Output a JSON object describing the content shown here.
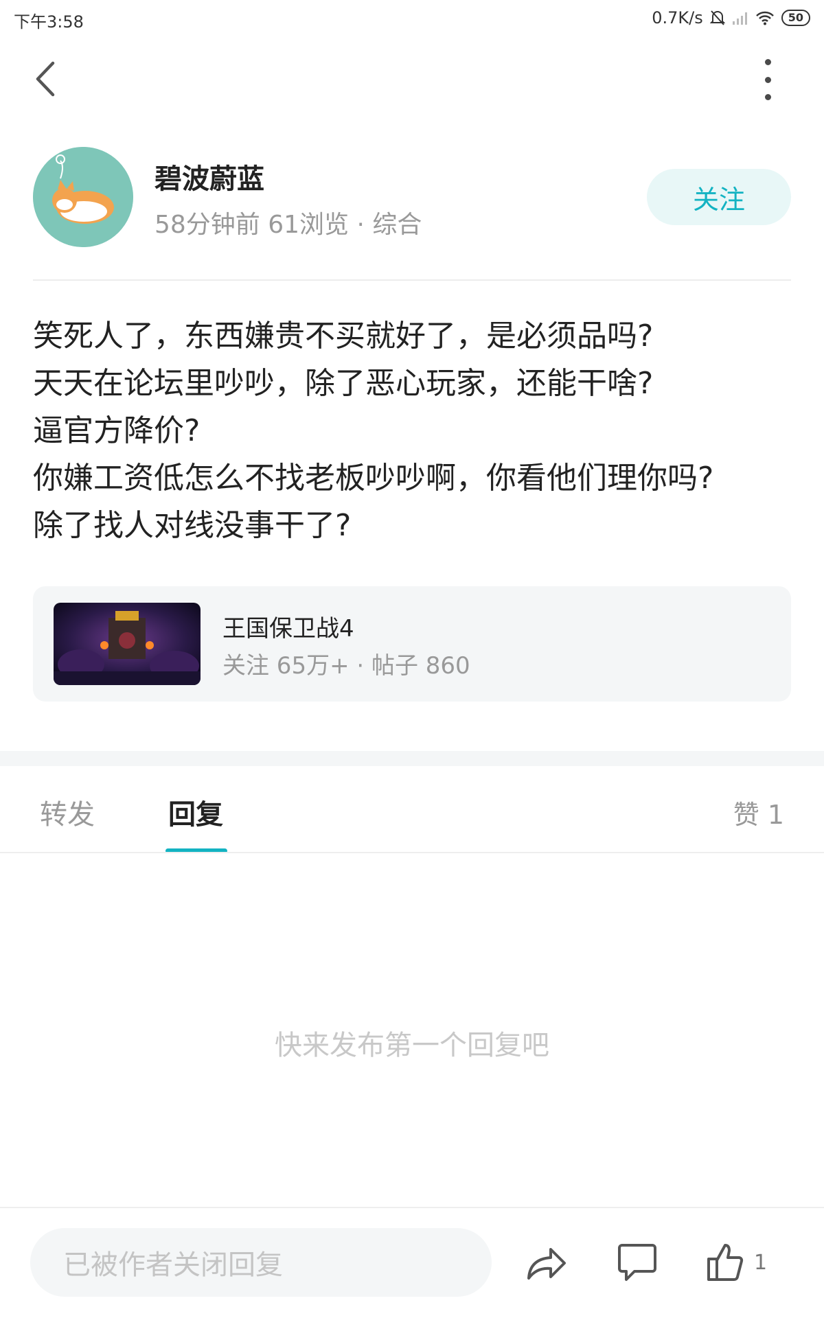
{
  "status_bar": {
    "time": "下午3:58",
    "network_speed": "0.7K/s",
    "battery": "50"
  },
  "author": {
    "name": "碧波蔚蓝",
    "meta": "58分钟前  61浏览 · 综合",
    "follow_label": "关注"
  },
  "post": {
    "lines": [
      "笑死人了，东西嫌贵不买就好了，是必须品吗?",
      "天天在论坛里吵吵，除了恶心玩家，还能干啥?",
      "逼官方降价?",
      "你嫌工资低怎么不找老板吵吵啊，你看他们理你吗?",
      "除了找人对线没事干了?"
    ]
  },
  "game_card": {
    "name": "王国保卫战4",
    "stats": "关注 65万+ · 帖子 860"
  },
  "tabs": {
    "forward": "转发",
    "reply": "回复",
    "likes": "赞 1"
  },
  "empty_hint": "快来发布第一个回复吧",
  "bottom_bar": {
    "input_placeholder": "已被作者关闭回复",
    "like_count": "1"
  },
  "colors": {
    "accent": "#13b3c2",
    "follow_bg": "#e8f7f7",
    "muted_text": "#999999",
    "card_bg": "#f4f6f7"
  },
  "icons": [
    "back-arrow-icon",
    "more-vertical-icon",
    "share-icon",
    "comment-icon",
    "thumbs-up-icon",
    "wifi-icon",
    "signal-icon",
    "mute-bell-icon"
  ]
}
